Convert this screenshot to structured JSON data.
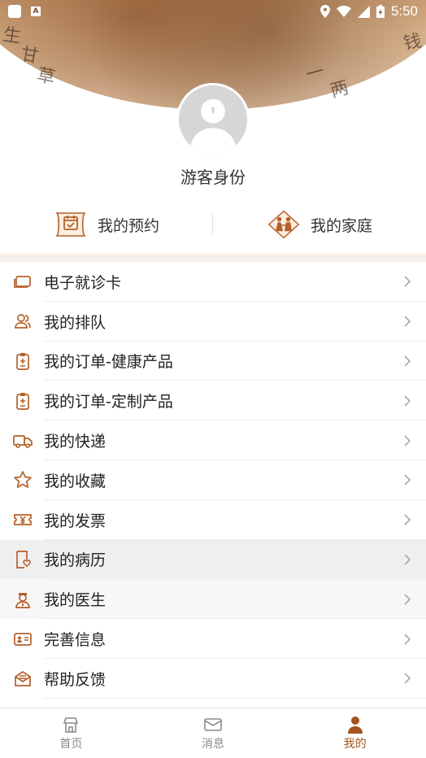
{
  "status_bar": {
    "time": "5:50"
  },
  "banner": {
    "chars": [
      "生",
      "甘",
      "草",
      "钱",
      "一",
      "两"
    ]
  },
  "profile": {
    "name": "游客身份"
  },
  "quick_actions": [
    {
      "label": "我的预约",
      "icon": "calendar-scroll-icon"
    },
    {
      "label": "我的家庭",
      "icon": "family-icon"
    }
  ],
  "menu": [
    {
      "label": "电子就诊卡",
      "icon": "card-icon"
    },
    {
      "label": "我的排队",
      "icon": "queue-people-icon"
    },
    {
      "label": "我的订单-健康产品",
      "icon": "order-clipboard-icon"
    },
    {
      "label": "我的订单-定制产品",
      "icon": "order-clipboard-icon"
    },
    {
      "label": "我的快递",
      "icon": "truck-icon"
    },
    {
      "label": "我的收藏",
      "icon": "star-icon"
    },
    {
      "label": "我的发票",
      "icon": "invoice-ticket-icon"
    },
    {
      "label": "我的病历",
      "icon": "medical-record-icon"
    },
    {
      "label": "我的医生",
      "icon": "doctor-icon"
    },
    {
      "label": "完善信息",
      "icon": "id-card-icon"
    },
    {
      "label": "帮助反馈",
      "icon": "feedback-mail-icon"
    }
  ],
  "bottom_nav": [
    {
      "label": "首页",
      "icon": "home-icon",
      "active": false
    },
    {
      "label": "消息",
      "icon": "mail-icon",
      "active": false
    },
    {
      "label": "我的",
      "icon": "person-icon",
      "active": true
    }
  ],
  "colors": {
    "accent": "#a3541f",
    "icon_brown": "#b5602a"
  }
}
